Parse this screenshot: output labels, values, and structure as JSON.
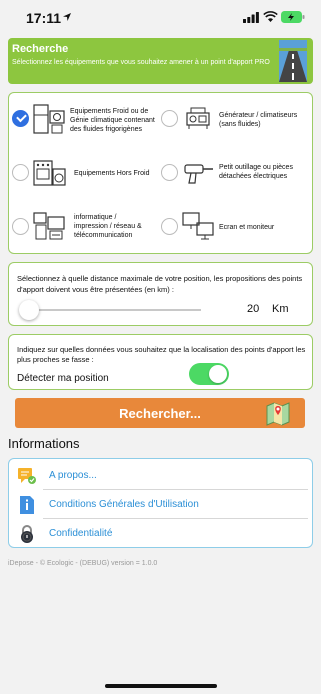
{
  "status_bar": {
    "time": "17:11"
  },
  "header": {
    "title": "Recherche",
    "subtitle": "Sélectionnez les équipements que vous souhaitez amener à un point d'apport PRO"
  },
  "equipment": {
    "items": [
      {
        "label": "Equipements Froid ou de Génie climatique contenant des fluides frigorigènes",
        "checked": true,
        "icon": "fridge-icon"
      },
      {
        "label": "Générateur / climatiseurs (sans fluides)",
        "checked": false,
        "icon": "generator-icon"
      },
      {
        "label": "Equipements Hors Froid",
        "checked": false,
        "icon": "stove-icon"
      },
      {
        "label": "Petit outillage ou pièces détachées électriques",
        "checked": false,
        "icon": "drill-icon"
      },
      {
        "label": "informatique / impression / réseau & télécommunication",
        "checked": false,
        "icon": "computer-icon"
      },
      {
        "label": "Ecran et moniteur",
        "checked": false,
        "icon": "monitor-icon"
      }
    ]
  },
  "distance": {
    "text": "Sélectionnez à quelle distance maximale de votre position, les propositions des points d'apport doivent vous être présentées (en km) :",
    "value": "20",
    "unit": "Km"
  },
  "location": {
    "text": "Indiquez sur quelles données vous souhaitez que la localisation des points d'apport les plus proches se fasse :",
    "detect_label": "Détecter ma position",
    "toggle_on": true
  },
  "search_button": {
    "label": "Rechercher..."
  },
  "informations": {
    "title": "Informations",
    "items": [
      {
        "label": "A propos...",
        "icon": "chat-icon"
      },
      {
        "label": "Conditions Générales d'Utilisation",
        "icon": "document-info-icon"
      },
      {
        "label": "Confidentialité",
        "icon": "lock-icon"
      }
    ]
  },
  "footer": {
    "text": "iDepose - © Ecologic - (DEBUG) version = 1.0.0"
  },
  "colors": {
    "header_green": "#8dc63f",
    "card_border": "#9ccc65",
    "radio_checked": "#2f6fe0",
    "search_orange": "#e8883a",
    "link_blue": "#2b8fd6",
    "toggle_green": "#4cd964"
  }
}
